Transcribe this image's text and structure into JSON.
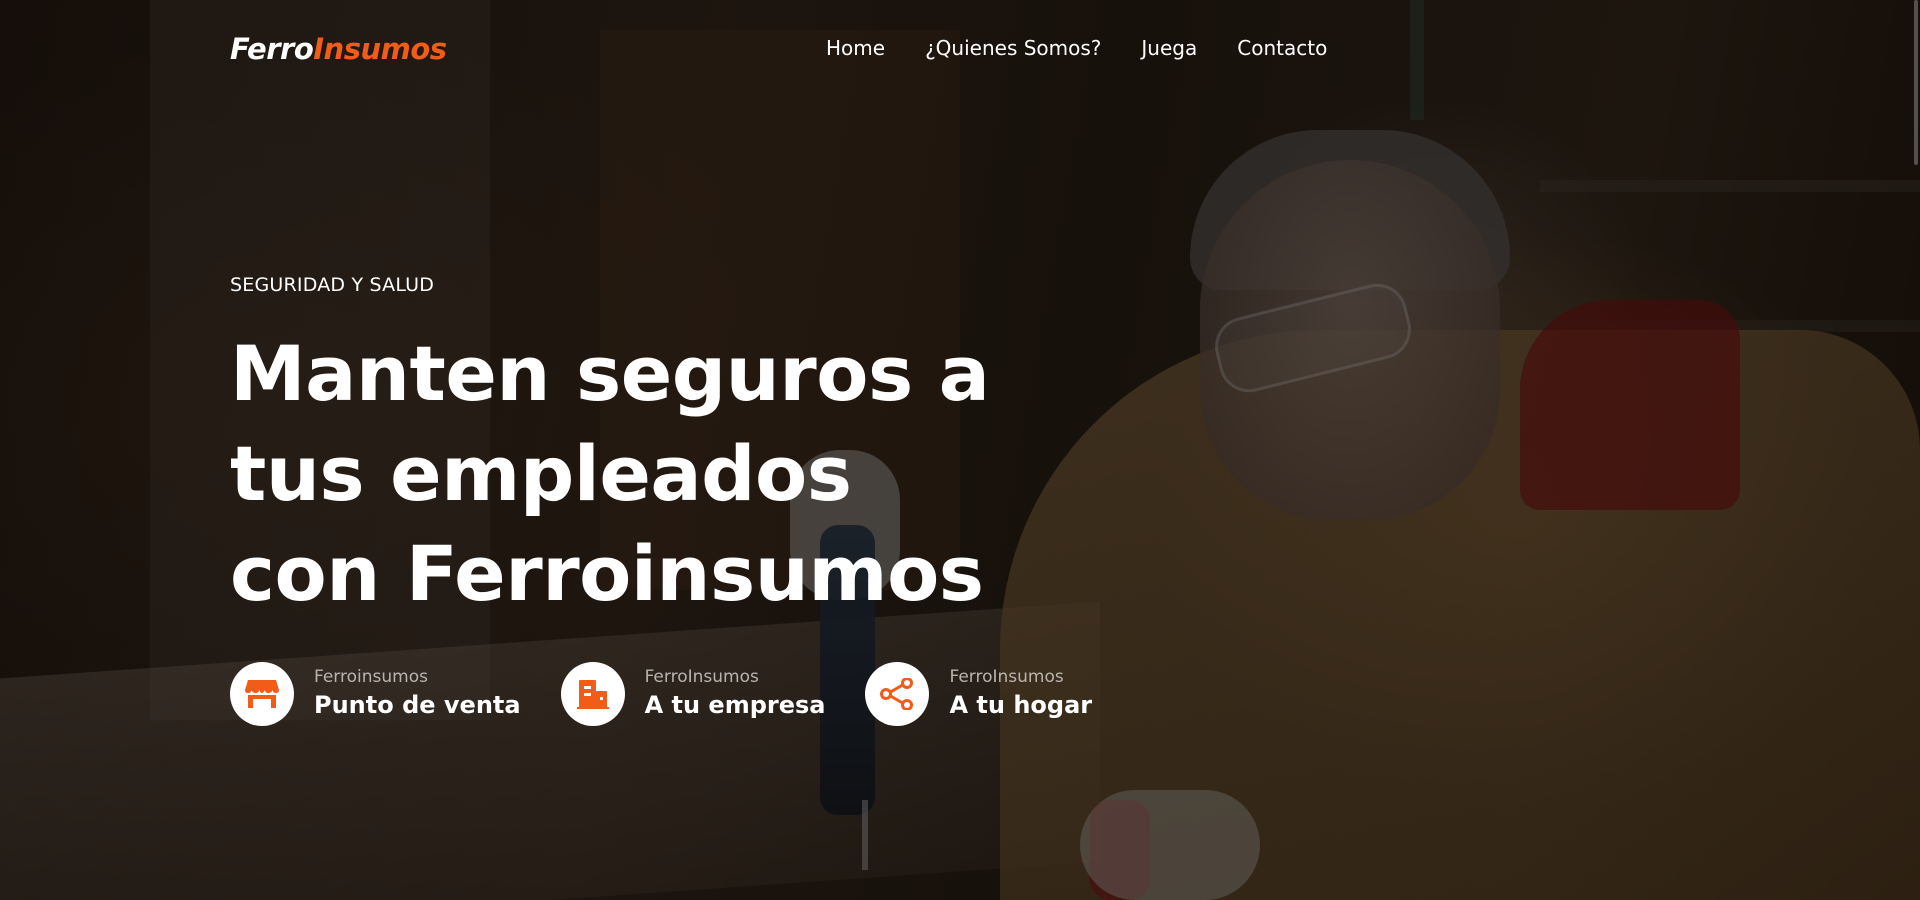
{
  "colors": {
    "accent": "#f25c19",
    "text": "#ffffff",
    "muted": "#b9b3ae"
  },
  "header": {
    "logo": {
      "part1": "Ferro",
      "part2": "Insumos"
    },
    "nav": [
      {
        "label": "Home"
      },
      {
        "label": "¿Quienes Somos?"
      },
      {
        "label": "Juega"
      },
      {
        "label": "Contacto"
      }
    ]
  },
  "hero": {
    "eyebrow": "SEGURIDAD Y SALUD",
    "headline_lines": [
      "Manten seguros a",
      "tus empleados",
      "con Ferroinsumos"
    ],
    "features": [
      {
        "kicker": "Ferroinsumos",
        "title": "Punto de venta",
        "icon": "store-icon"
      },
      {
        "kicker": "FerroInsumos",
        "title": "A tu empresa",
        "icon": "building-icon"
      },
      {
        "kicker": "FerroInsumos",
        "title": "A tu hogar",
        "icon": "share-icon"
      }
    ]
  }
}
